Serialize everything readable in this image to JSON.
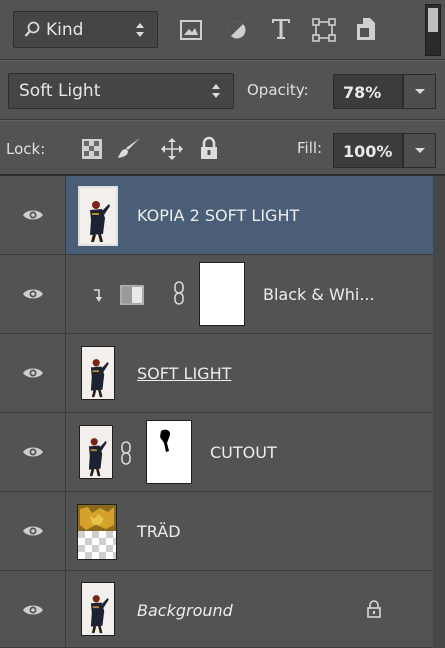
{
  "filter": {
    "kind_label": "Kind",
    "icons": [
      "search-icon",
      "image-filter-icon",
      "adjustment-filter-icon",
      "type-filter-icon",
      "shape-filter-icon",
      "smart-object-filter-icon"
    ]
  },
  "blend": {
    "mode": "Soft Light",
    "opacity_label": "Opacity:",
    "opacity_value": "78%"
  },
  "lock": {
    "label": "Lock:",
    "icons": [
      "lock-transparent-pixels-icon",
      "lock-image-pixels-icon",
      "lock-position-icon",
      "lock-all-icon"
    ],
    "fill_label": "Fill:",
    "fill_value": "100%"
  },
  "layers": [
    {
      "name": "KOPIA 2 SOFT LIGHT",
      "selected": true,
      "visible": true
    },
    {
      "name": "Black & Whi...",
      "type": "adjustment",
      "clipped": true,
      "visible": true
    },
    {
      "name": "SOFT LIGHT",
      "underline": true,
      "visible": true
    },
    {
      "name": "CUTOUT",
      "has_mask": true,
      "visible": true
    },
    {
      "name": "TRÄD",
      "visible": true
    },
    {
      "name": "Background",
      "italic": true,
      "locked": true,
      "visible": true
    }
  ],
  "colors": {
    "panel": "#535353",
    "selected_row": "#4a5e77",
    "field": "#454545"
  }
}
